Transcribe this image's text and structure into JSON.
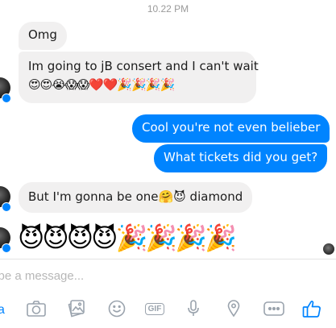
{
  "header": {
    "timestamp": "10.22 PM"
  },
  "messages": [
    {
      "text": "Omg"
    },
    {
      "text": "Im going to jB consert and I can't wait",
      "emoji": "😍😍😭😱😱❤️❤️🎉🎉🎉🎉"
    },
    {
      "text": "Cool you're not even belieber"
    },
    {
      "text": "What tickets did you get?"
    },
    {
      "text": "But I'm gonna be one🤗😈 diamond"
    },
    {
      "emoji": "😈😈😈😈🎉🎉🎉🎉"
    }
  ],
  "composer": {
    "placeholder": "ype a message..."
  },
  "toolbar": {
    "gif_label": "GIF",
    "icons": [
      "text-aa-icon",
      "camera-icon",
      "photo-icon",
      "emoji-icon",
      "gif-icon",
      "microphone-icon",
      "location-icon",
      "more-icon",
      "like-icon"
    ]
  },
  "colors": {
    "accent": "#0084ff",
    "incoming_bubble": "#f1f0f0",
    "toolbar_icon": "#9aa3ad"
  }
}
